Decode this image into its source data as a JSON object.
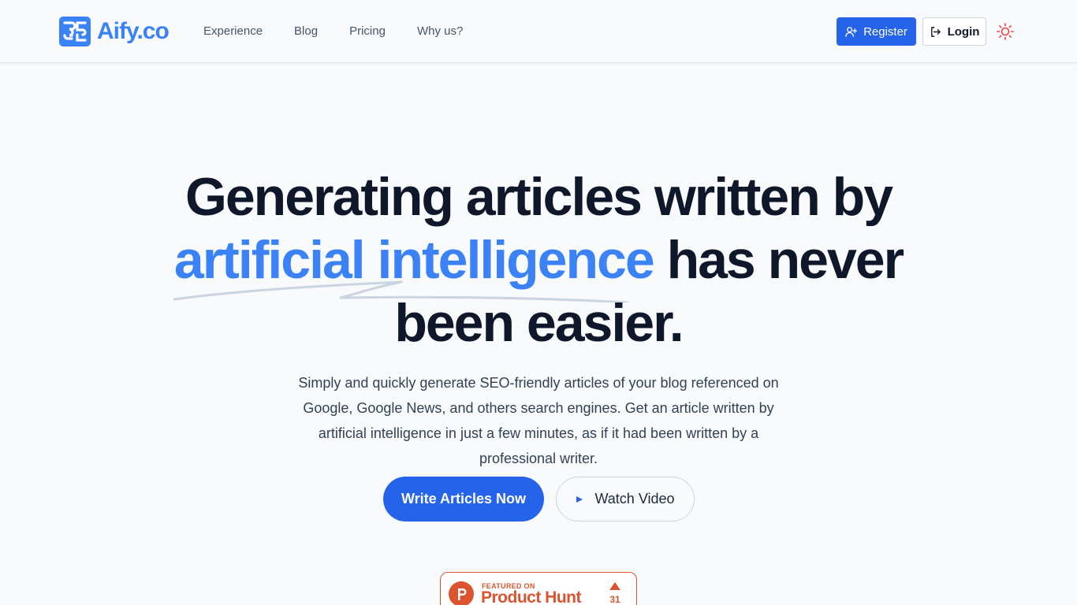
{
  "header": {
    "logo_text": "Aify.co",
    "nav": [
      {
        "label": "Experience"
      },
      {
        "label": "Blog"
      },
      {
        "label": "Pricing"
      },
      {
        "label": "Why us?"
      }
    ],
    "register_label": "Register",
    "login_label": "Login",
    "theme_icon": "sun-icon"
  },
  "hero": {
    "title_line1": "Generating articles written by",
    "title_highlight": "artificial intelligence",
    "title_rest": " has never",
    "title_line3": "been easier.",
    "subtitle": "Simply and quickly generate SEO-friendly articles of your blog referenced on Google, Google News, and others search engines. Get an article written by artificial intelligence in just a few minutes, as if it had been written by a professional writer.",
    "primary_cta": "Write Articles Now",
    "secondary_cta": "Watch Video"
  },
  "product_hunt": {
    "featured": "FEATURED ON",
    "name": "Product Hunt",
    "votes": "31"
  },
  "colors": {
    "brand": "#3b82f6",
    "primary_button": "#2563eb",
    "heading": "#0f172a",
    "product_hunt": "#da552f",
    "sun": "#ef4444"
  }
}
